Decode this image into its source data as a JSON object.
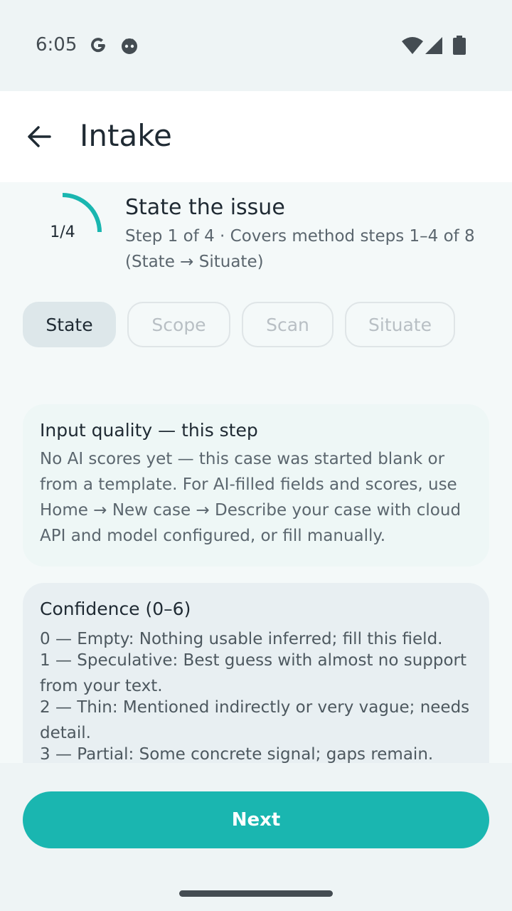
{
  "status": {
    "time": "6:05",
    "icons": [
      "google-icon",
      "android-face-icon",
      "wifi-icon",
      "signal-icon",
      "battery-icon"
    ]
  },
  "app_bar": {
    "title": "Intake",
    "back_icon": "arrow-back-icon"
  },
  "step": {
    "progress_text": "1/4",
    "progress_fraction": 0.25,
    "title": "State the issue",
    "subtitle": "Step 1 of 4 · Covers method steps 1–4 of 8 (State → Situate)"
  },
  "chips": [
    {
      "label": "State",
      "active": true
    },
    {
      "label": "Scope",
      "active": false
    },
    {
      "label": "Scan",
      "active": false
    },
    {
      "label": "Situate",
      "active": false
    }
  ],
  "input_quality": {
    "title": "Input quality — this step",
    "body": "No AI scores yet — this case was started blank or from a template. For AI-filled fields and scores, use Home → New case → Describe your case with cloud API and model configured, or fill manually."
  },
  "confidence": {
    "title": "Confidence (0–6)",
    "items": [
      "0 — Empty: Nothing usable inferred; fill this field.",
      "1 — Speculative: Best guess with almost no support from your text.",
      "2 — Thin: Mentioned indirectly or very vague; needs detail.",
      "3 — Partial: Some concrete signal; gaps remain."
    ]
  },
  "actions": {
    "next_label": "Next"
  },
  "colors": {
    "accent": "#1ab6b0",
    "background": "#eef4f5"
  }
}
